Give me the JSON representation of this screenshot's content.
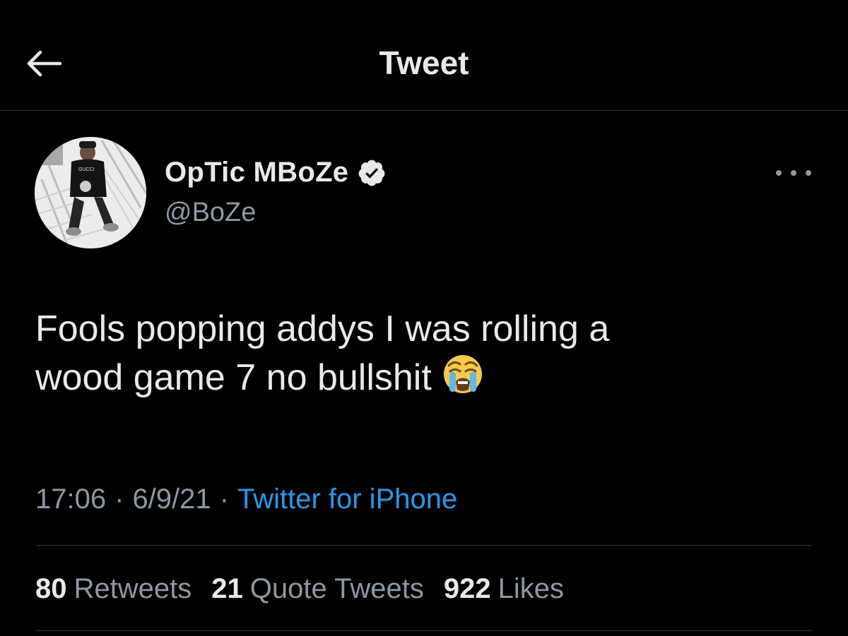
{
  "header": {
    "title": "Tweet",
    "back_icon": "arrow-left-icon"
  },
  "author": {
    "display_name": "OpTic MBoZe",
    "handle": "@BoZe",
    "verified": true,
    "verified_icon": "verified-badge-icon",
    "avatar_shirt_text": "GUCCI"
  },
  "more_icon": "more-horizontal-icon",
  "tweet": {
    "text_line1": "Fools popping addys I was rolling a",
    "text_line2": "wood game 7 no bullshit",
    "emoji": "loudly-crying-face-emoji"
  },
  "meta": {
    "time": "17:06",
    "separator": "·",
    "date": "6/9/21",
    "source": "Twitter for iPhone"
  },
  "stats": {
    "retweets_count": "80",
    "retweets_label": "Retweets",
    "quotes_count": "21",
    "quotes_label": "Quote Tweets",
    "likes_count": "922",
    "likes_label": "Likes"
  },
  "colors": {
    "background": "#000000",
    "text_primary": "#e7e9ea",
    "text_secondary": "#8b98a5",
    "accent": "#1d9bf0",
    "divider": "#2f3336"
  }
}
